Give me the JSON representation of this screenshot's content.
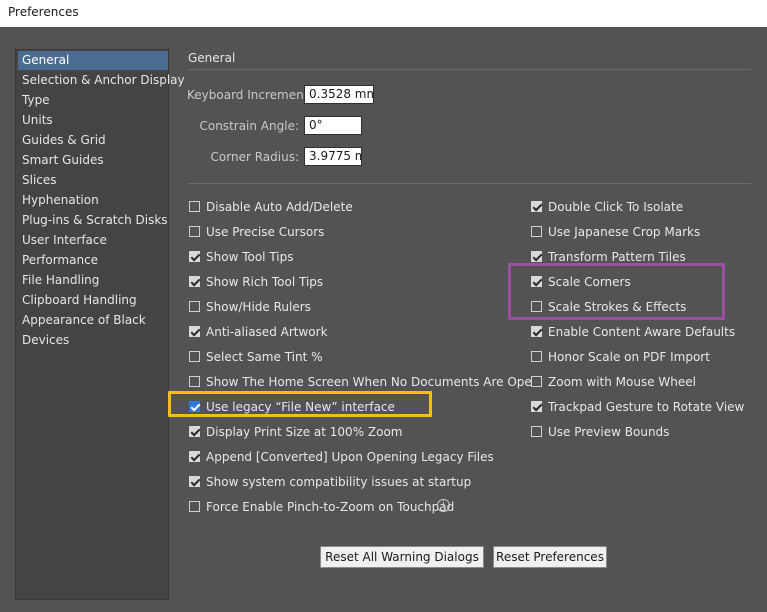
{
  "window": {
    "title": "Preferences"
  },
  "sidebar": {
    "items": [
      {
        "label": "General",
        "selected": true
      },
      {
        "label": "Selection & Anchor Display"
      },
      {
        "label": "Type"
      },
      {
        "label": "Units"
      },
      {
        "label": "Guides & Grid"
      },
      {
        "label": "Smart Guides"
      },
      {
        "label": "Slices"
      },
      {
        "label": "Hyphenation"
      },
      {
        "label": "Plug-ins & Scratch Disks"
      },
      {
        "label": "User Interface"
      },
      {
        "label": "Performance"
      },
      {
        "label": "File Handling"
      },
      {
        "label": "Clipboard Handling"
      },
      {
        "label": "Appearance of Black"
      },
      {
        "label": "Devices"
      }
    ]
  },
  "main": {
    "section_title": "General",
    "fields": {
      "keyboard_increment": {
        "label": "Keyboard Increment:",
        "value": "0.3528 mm"
      },
      "constrain_angle": {
        "label": "Constrain Angle:",
        "value": "0°"
      },
      "corner_radius": {
        "label": "Corner Radius:",
        "value": "3.9775 m"
      }
    },
    "left_options": [
      {
        "label": "Disable Auto Add/Delete",
        "checked": false
      },
      {
        "label": "Use Precise Cursors",
        "checked": false
      },
      {
        "label": "Show Tool Tips",
        "checked": true
      },
      {
        "label": "Show Rich Tool Tips",
        "checked": true
      },
      {
        "label": "Show/Hide Rulers",
        "checked": false
      },
      {
        "label": "Anti-aliased Artwork",
        "checked": true
      },
      {
        "label": "Select Same Tint %",
        "checked": false
      },
      {
        "label": "Show The Home Screen When No Documents Are Open",
        "checked": false
      },
      {
        "label": "Use legacy “File New” interface",
        "checked": true
      },
      {
        "label": "Display Print Size at 100% Zoom",
        "checked": true
      },
      {
        "label": "Append [Converted] Upon Opening Legacy Files",
        "checked": true
      },
      {
        "label": "Show system compatibility issues at startup",
        "checked": true
      },
      {
        "label": "Force Enable Pinch-to-Zoom on Touchpad",
        "checked": false
      }
    ],
    "right_options": [
      {
        "label": "Double Click To Isolate",
        "checked": true
      },
      {
        "label": "Use Japanese Crop Marks",
        "checked": false
      },
      {
        "label": "Transform Pattern Tiles",
        "checked": true
      },
      {
        "label": "Scale Corners",
        "checked": true
      },
      {
        "label": "Scale Strokes & Effects",
        "checked": false
      },
      {
        "label": "Enable Content Aware Defaults",
        "checked": true
      },
      {
        "label": "Honor Scale on PDF Import",
        "checked": false
      },
      {
        "label": "Zoom with Mouse Wheel",
        "checked": false
      },
      {
        "label": "Trackpad Gesture to Rotate View",
        "checked": true
      },
      {
        "label": "Use Preview Bounds",
        "checked": false
      }
    ],
    "info_icon_glyph": "i",
    "buttons": {
      "reset_warnings": "Reset All Warning Dialogs",
      "reset_prefs": "Reset Preferences"
    }
  },
  "annotations": {
    "yellow_highlight_color": "#f5be17",
    "purple_highlight_color": "#9b4fa3"
  }
}
